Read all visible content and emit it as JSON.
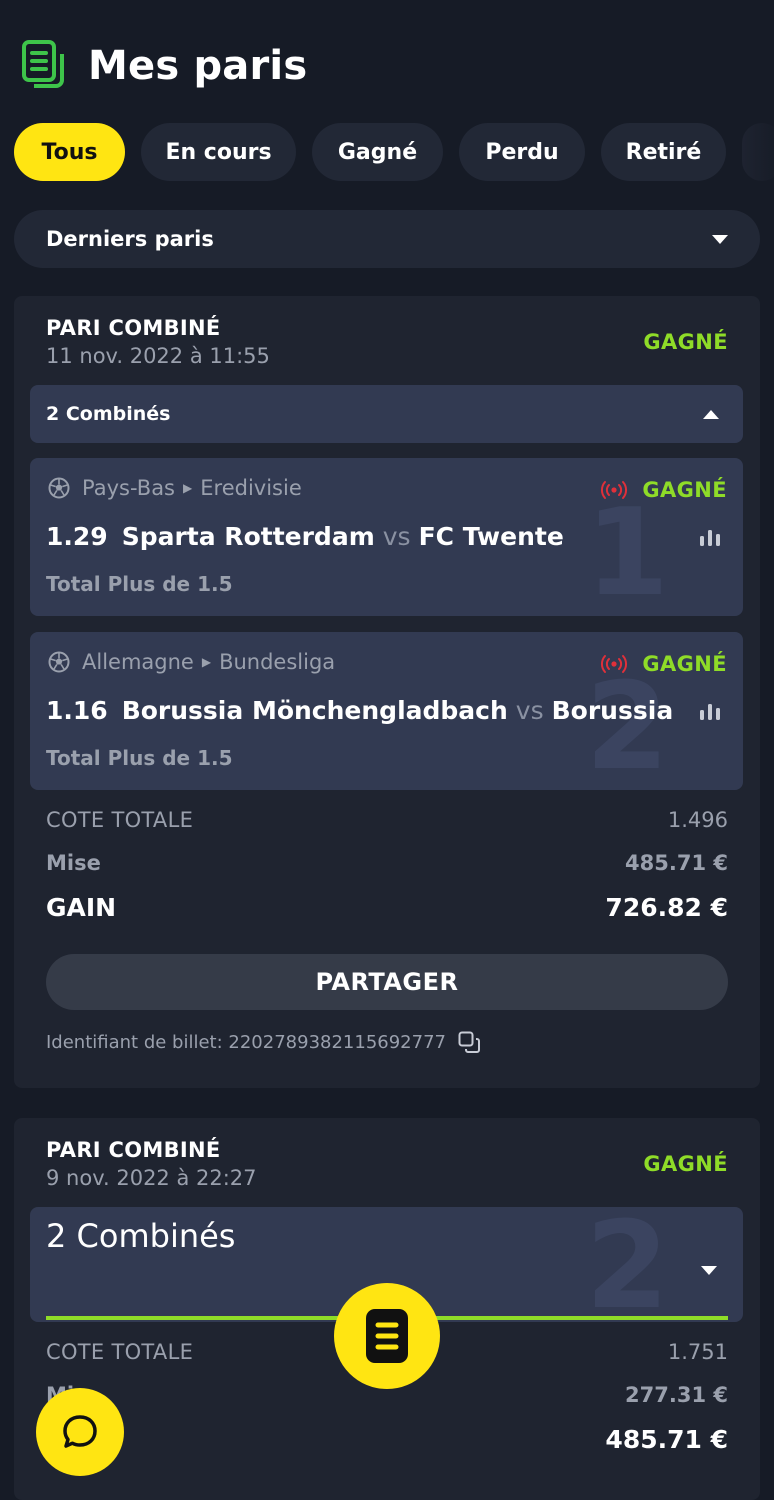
{
  "header": {
    "title": "Mes paris",
    "icon": "bets-document-icon"
  },
  "filters": [
    {
      "label": "Tous",
      "active": true
    },
    {
      "label": "En cours",
      "active": false
    },
    {
      "label": "Gagné",
      "active": false
    },
    {
      "label": "Perdu",
      "active": false
    },
    {
      "label": "Retiré",
      "active": false
    }
  ],
  "sort_dropdown": {
    "label": "Derniers paris"
  },
  "bets": [
    {
      "type": "PARI COMBINÉ",
      "date": "11 nov. 2022 à 11:55",
      "status": "GAGNÉ",
      "combo_label": "2 Combinés",
      "selections": [
        {
          "index": "1",
          "country": "Pays-Bas",
          "league": "Eredivisie",
          "status": "GAGNÉ",
          "odd": "1.29",
          "home": "Sparta Rotterdam",
          "vs": "vs",
          "away": "FC Twente",
          "market": "Total Plus de 1.5"
        },
        {
          "index": "2",
          "country": "Allemagne",
          "league": "Bundesliga",
          "status": "GAGNÉ",
          "odd": "1.16",
          "home": "Borussia Mönchengladbach",
          "vs": "vs",
          "away": "Borussia Dor",
          "market": "Total Plus de 1.5"
        }
      ],
      "total_odds_label": "COTE TOTALE",
      "total_odds": "1.496",
      "stake_label": "Mise",
      "stake": "485.71 €",
      "gain_label": "GAIN",
      "gain": "726.82 €",
      "share_label": "PARTAGER",
      "ticket_label": "Identifiant de billet: 2202789382115692777"
    },
    {
      "type": "PARI COMBINÉ",
      "date": "9 nov. 2022 à 22:27",
      "status": "GAGNÉ",
      "combo_label": "2 Combinés",
      "combo_count": "2",
      "total_odds_label": "COTE TOTALE",
      "total_odds": "1.751",
      "stake_label": "Mi",
      "stake": "277.31 €",
      "gain": "485.71 €"
    }
  ],
  "colors": {
    "accent": "#ffe512",
    "won": "#8fdc28",
    "live": "#e0303a",
    "background": "#161b26",
    "card": "#1f2430",
    "selection": "#323a52"
  }
}
